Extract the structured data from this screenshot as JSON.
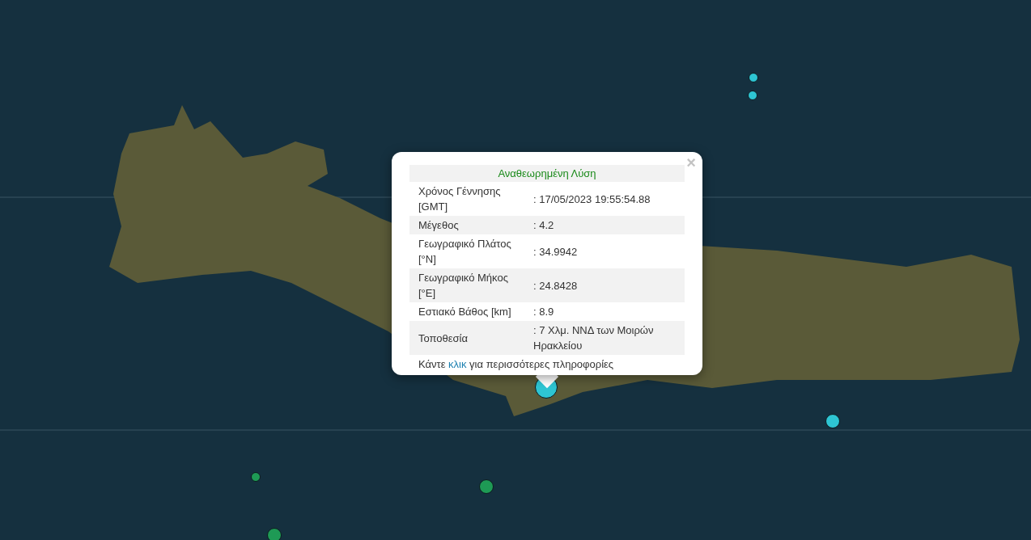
{
  "popup": {
    "title": "Αναθεωρημένη Λύση",
    "rows": [
      {
        "label": "Χρόνος Γέννησης [GMT]",
        "value": ": 17/05/2023 19:55:54.88"
      },
      {
        "label": "Μέγεθος",
        "value": ": 4.2"
      },
      {
        "label": "Γεωγραφικό Πλάτος [°N]",
        "value": ": 34.9942"
      },
      {
        "label": "Γεωγραφικό Μήκος [°E]",
        "value": ": 24.8428"
      },
      {
        "label": "Εστιακό Βάθος [km]",
        "value": ": 8.9"
      },
      {
        "label": "Τοποθεσία",
        "value": ": 7 Χλμ. ΝΝΔ των Μοιρών Ηρακλείου"
      }
    ],
    "footer": {
      "before": "Κάντε",
      "link": "κλικ",
      "after": "για περισσότερες πληροφορίες"
    },
    "close": "×"
  },
  "markers": [
    {
      "color": "#2ec5d3",
      "kind": "small"
    },
    {
      "color": "#2ec5d3",
      "kind": "small"
    },
    {
      "color": "#2ec5d3",
      "kind": "large"
    },
    {
      "color": "#2ec5d3",
      "kind": "medium"
    },
    {
      "color": "#1e9a55",
      "kind": "small"
    },
    {
      "color": "#1e9a55",
      "kind": "medium"
    },
    {
      "color": "#1e9a55",
      "kind": "medium"
    }
  ]
}
